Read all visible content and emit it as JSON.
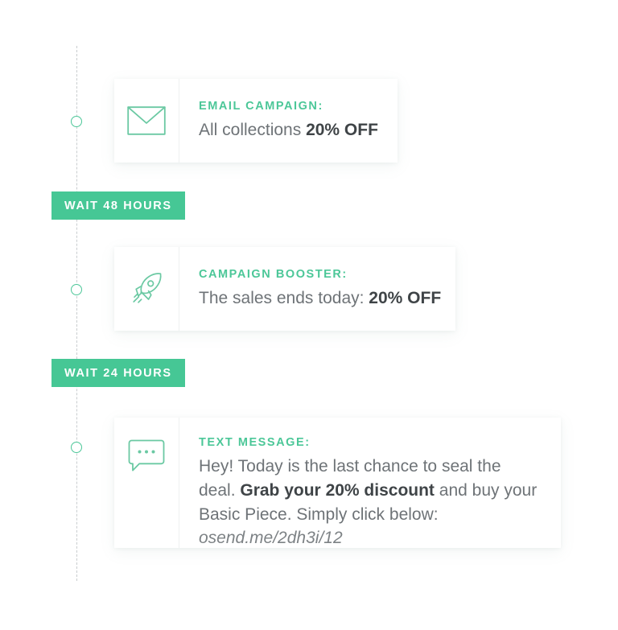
{
  "timeline": {
    "dots": [
      "step-dot-1",
      "step-dot-2",
      "step-dot-3"
    ],
    "line_style": "dashed-vertical",
    "accent_color": "#4cc798",
    "line_color": "#c9cdcf"
  },
  "waits": [
    {
      "label": "WAIT 48 HOURS",
      "bg_color": "#46c795",
      "text_color": "#ffffff"
    },
    {
      "label": "WAIT 24 HOURS",
      "bg_color": "#46c795",
      "text_color": "#ffffff"
    }
  ],
  "steps": [
    {
      "icon": "envelope-icon",
      "kicker": "EMAIL CAMPAIGN:",
      "text_parts": [
        {
          "text": "All collections ",
          "style": "normal"
        },
        {
          "text": "20% OFF",
          "style": "bold"
        }
      ]
    },
    {
      "icon": "rocket-icon",
      "kicker": "CAMPAIGN BOOSTER:",
      "text_parts": [
        {
          "text": "The sales ends today: ",
          "style": "normal"
        },
        {
          "text": "20% OFF",
          "style": "bold"
        }
      ]
    },
    {
      "icon": "chat-bubble-icon",
      "kicker": "TEXT MESSAGE:",
      "text_parts": [
        {
          "text": "Hey! Today is the last chance to seal the deal. ",
          "style": "normal"
        },
        {
          "text": "Grab your 20% discount",
          "style": "bold"
        },
        {
          "text": " and buy your Basic Piece. Simply click below: ",
          "style": "normal"
        },
        {
          "text": "osend.me/2dh3i/12",
          "style": "italic"
        }
      ]
    }
  ]
}
